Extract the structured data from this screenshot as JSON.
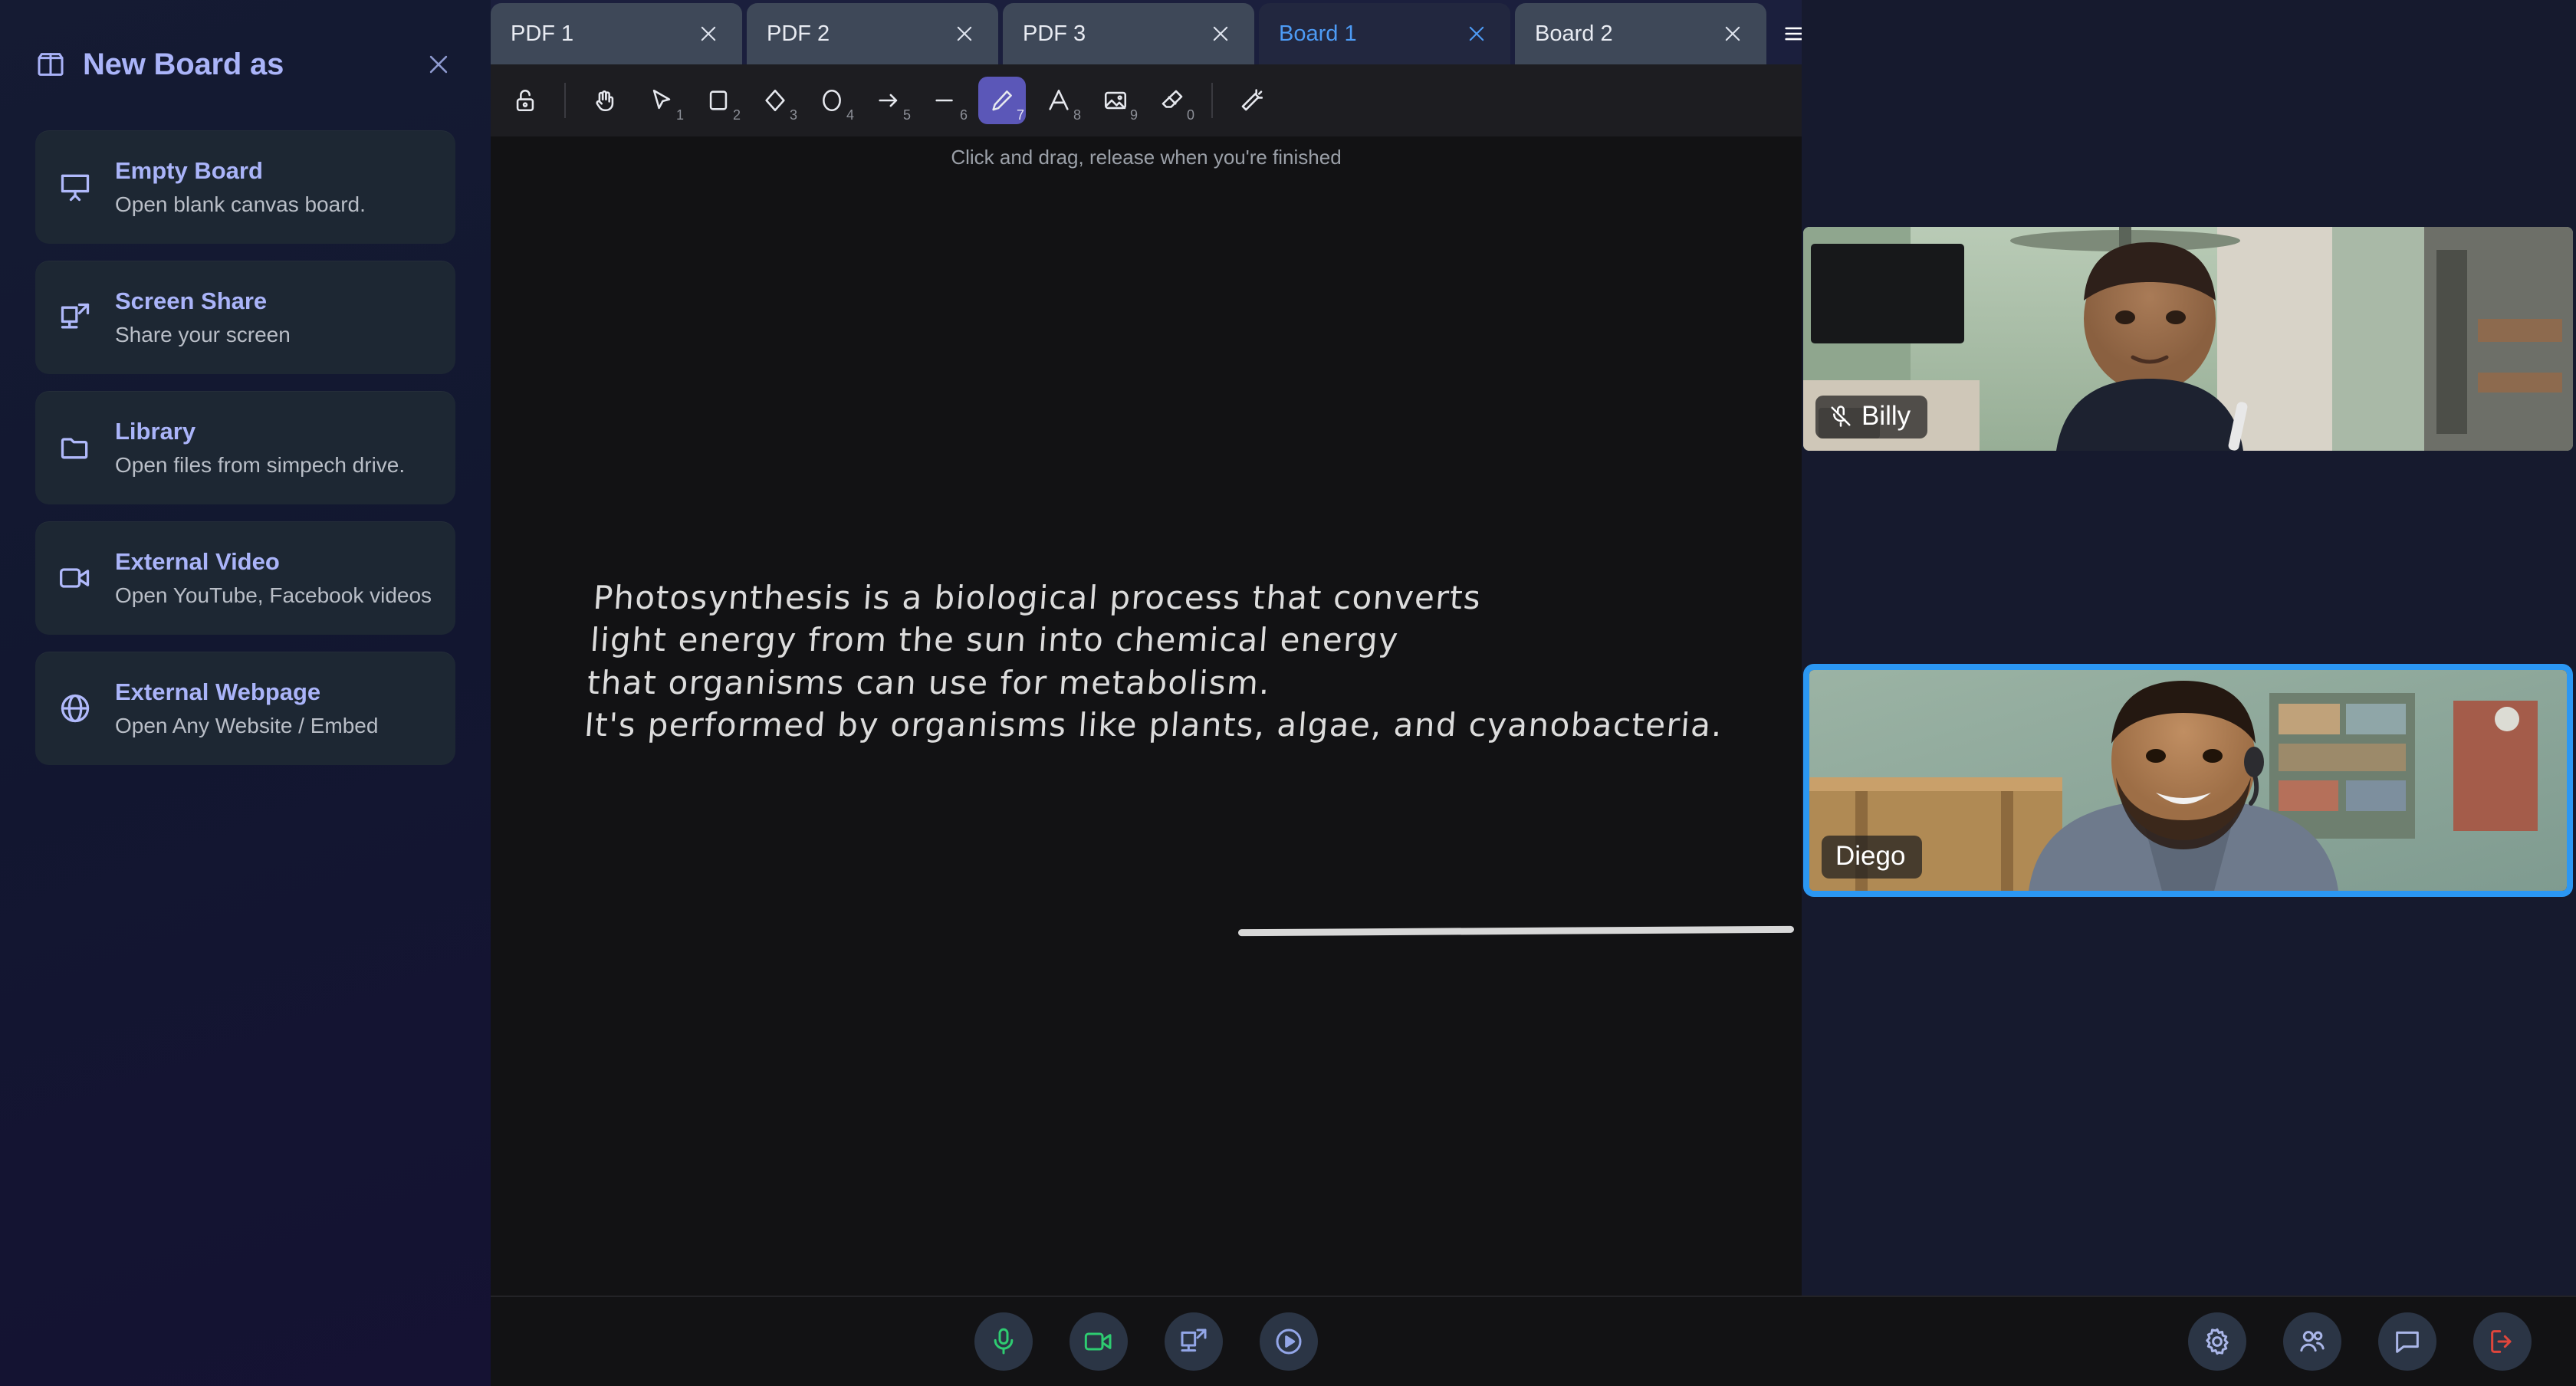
{
  "sidebar": {
    "icon": "box-icon",
    "title": "New Board as",
    "close_icon": "close-icon",
    "items": [
      {
        "icon": "presentation-board-icon",
        "title": "Empty Board",
        "subtitle": "Open blank canvas board."
      },
      {
        "icon": "screen-share-icon",
        "title": "Screen Share",
        "subtitle": "Share your screen"
      },
      {
        "icon": "folder-icon",
        "title": "Library",
        "subtitle": "Open files from simpech drive."
      },
      {
        "icon": "video-camera-icon",
        "title": "External Video",
        "subtitle": "Open YouTube, Facebook videos"
      },
      {
        "icon": "globe-icon",
        "title": "External Webpage",
        "subtitle": "Open Any Website / Embed"
      }
    ]
  },
  "tabs": {
    "items": [
      {
        "label": "PDF 1",
        "active": false
      },
      {
        "label": "PDF 2",
        "active": false
      },
      {
        "label": "PDF 3",
        "active": false
      },
      {
        "label": "Board 1",
        "active": true
      },
      {
        "label": "Board 2",
        "active": false
      }
    ],
    "close_icon": "close-icon",
    "menu_icon": "hamburger-menu-icon"
  },
  "toolbar": {
    "tools": [
      {
        "icon": "lock-open-icon",
        "shortcut": "",
        "active": false,
        "name": "lock-tool"
      },
      {
        "icon": "hand-icon",
        "shortcut": "",
        "active": false,
        "name": "pan-tool"
      },
      {
        "icon": "cursor-icon",
        "shortcut": "1",
        "active": false,
        "name": "select-tool"
      },
      {
        "icon": "square-icon",
        "shortcut": "2",
        "active": false,
        "name": "rectangle-tool"
      },
      {
        "icon": "diamond-icon",
        "shortcut": "3",
        "active": false,
        "name": "diamond-tool"
      },
      {
        "icon": "circle-icon",
        "shortcut": "4",
        "active": false,
        "name": "ellipse-tool"
      },
      {
        "icon": "arrow-icon",
        "shortcut": "5",
        "active": false,
        "name": "arrow-tool"
      },
      {
        "icon": "line-icon",
        "shortcut": "6",
        "active": false,
        "name": "line-tool"
      },
      {
        "icon": "pencil-icon",
        "shortcut": "7",
        "active": true,
        "name": "draw-tool"
      },
      {
        "icon": "text-icon",
        "shortcut": "8",
        "active": false,
        "name": "text-tool"
      },
      {
        "icon": "image-icon",
        "shortcut": "9",
        "active": false,
        "name": "image-tool"
      },
      {
        "icon": "eraser-icon",
        "shortcut": "0",
        "active": false,
        "name": "eraser-tool"
      },
      {
        "icon": "magic-wand-icon",
        "shortcut": "",
        "active": false,
        "name": "laser-tool"
      }
    ]
  },
  "canvas": {
    "hint": "Click and drag, release when you're finished",
    "text": "Photosynthesis is a biological process that converts\nlight energy from the sun into chemical energy\nthat organisms can use for metabolism.\nIt's performed by organisms like plants, algae, and cyanobacteria."
  },
  "call_controls": {
    "left": [
      {
        "icon": "microphone-icon",
        "color": "#2ecc71",
        "name": "mic-button"
      },
      {
        "icon": "video-camera-icon",
        "color": "#2ecc71",
        "name": "camera-button"
      },
      {
        "icon": "screen-share-icon",
        "color": "#93a6e8",
        "name": "share-screen-button"
      },
      {
        "icon": "play-circle-icon",
        "color": "#93a6e8",
        "name": "play-media-button"
      }
    ],
    "right": [
      {
        "icon": "gear-icon",
        "color": "#aab6e8",
        "name": "settings-button"
      },
      {
        "icon": "participants-icon",
        "color": "#aab6e8",
        "name": "participants-button"
      },
      {
        "icon": "chat-icon",
        "color": "#aab6e8",
        "name": "chat-button"
      },
      {
        "icon": "leave-call-icon",
        "color": "#e0463c",
        "name": "leave-call-button"
      }
    ]
  },
  "participants": [
    {
      "name": "Billy",
      "muted": true,
      "active_speaker": false
    },
    {
      "name": "Diego",
      "muted": false,
      "active_speaker": true
    }
  ],
  "colors": {
    "accent": "#aab4f9",
    "active_tab_text": "#4d9bf5",
    "active_tool_bg": "#5b57b8",
    "speaker_border": "#2b97f3",
    "mic_on": "#2ecc71",
    "leave": "#e0463c"
  }
}
